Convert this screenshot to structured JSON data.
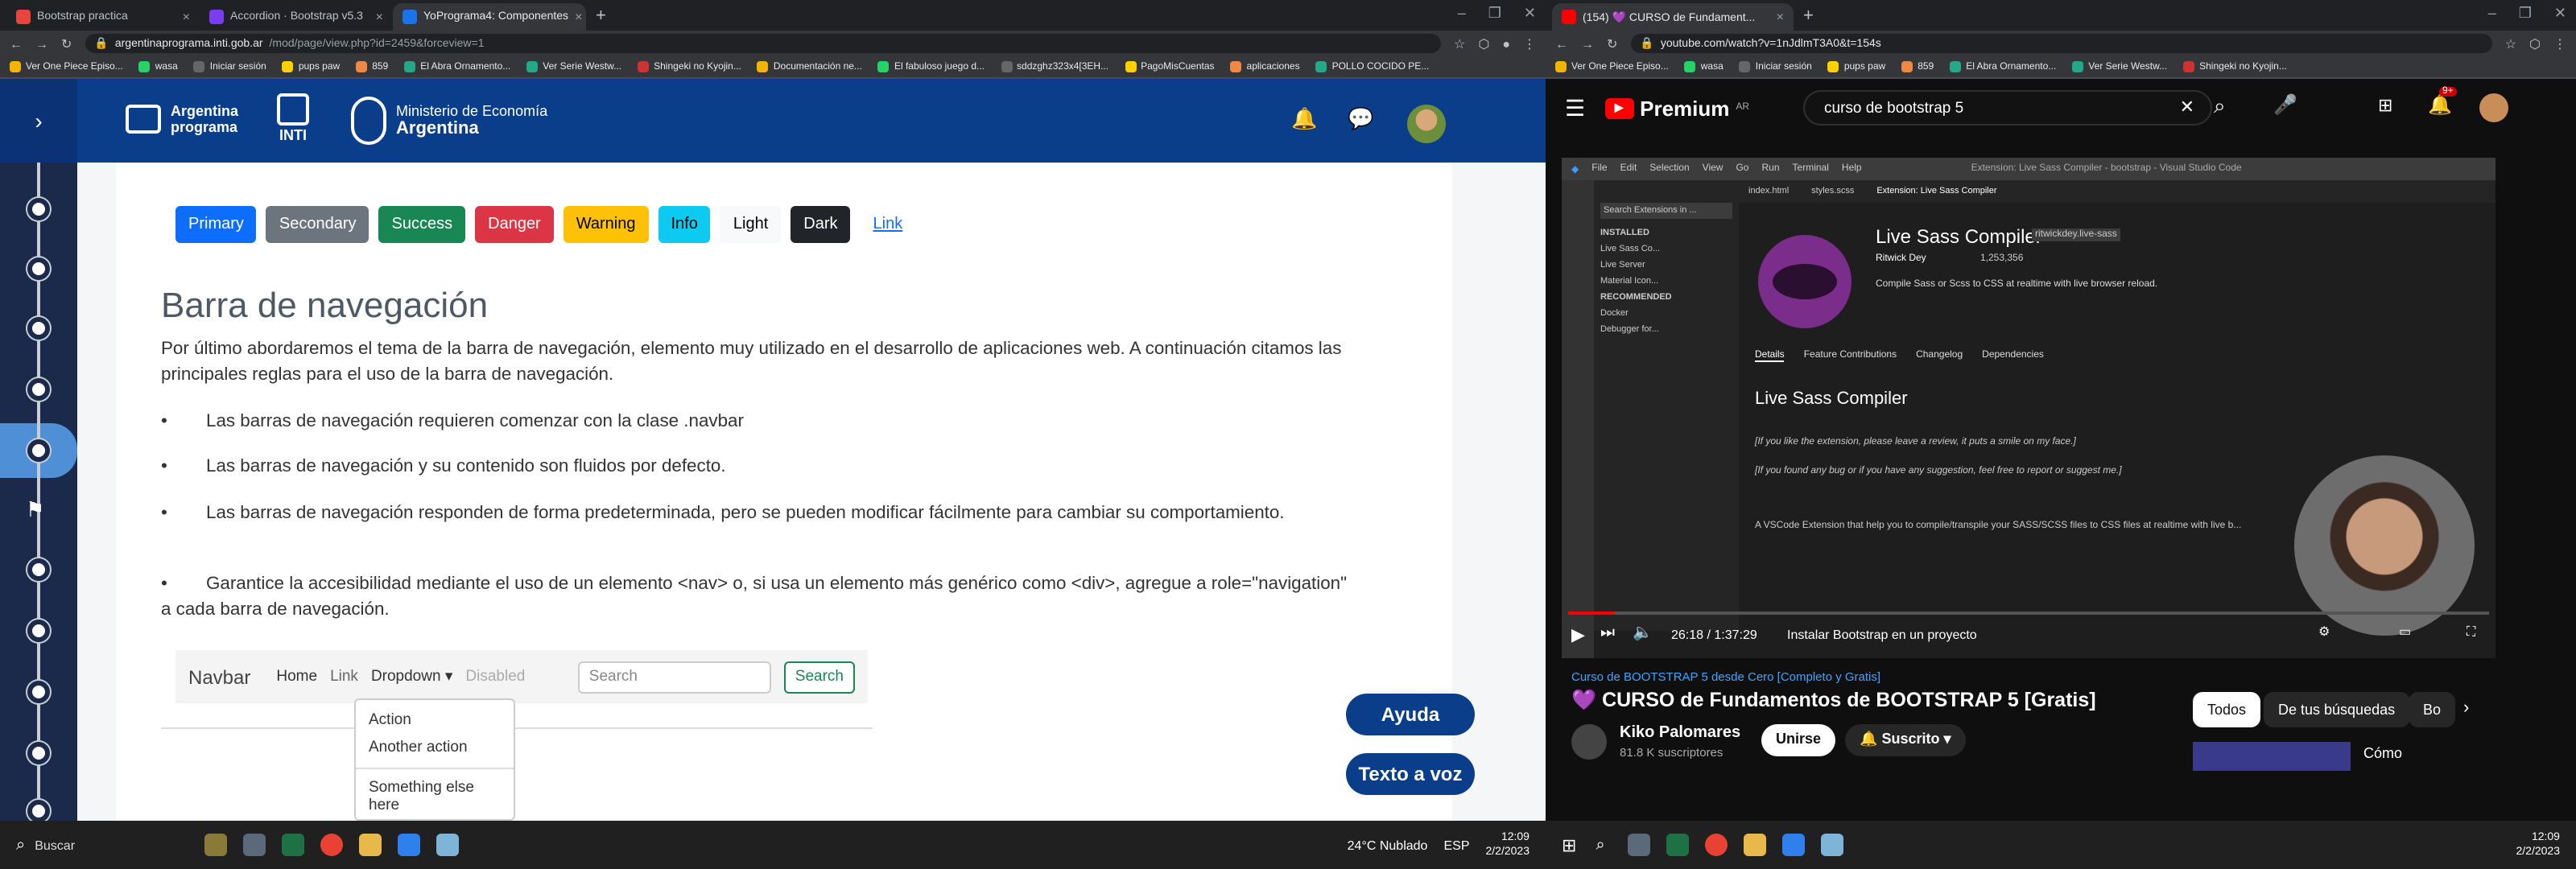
{
  "left": {
    "tabs": [
      {
        "label": "Bootstrap practica",
        "color": "#e8453c"
      },
      {
        "label": "Accordion · Bootstrap v5.3",
        "color": "#7a3ef0"
      },
      {
        "label": "YoPrograma4: Componentes",
        "color": "#1a73e8"
      }
    ],
    "url_domain": "argentinaprograma.inti.gob.ar",
    "url_path": "/mod/page/view.php?id=2459&forceview=1",
    "bookmarks": [
      "Ver One Piece Episo...",
      "wasa",
      "Iniciar sesión",
      "pups paw",
      "859",
      "El Abra Ornamento...",
      "Ver Serie Westw...",
      "Shingeki no Kyojin...",
      "Documentación ne...",
      "El fabuloso juego d...",
      "sddzghz323x4[3EH...",
      "PagoMisCuentas",
      "aplicaciones",
      "POLLO COCIDO PE..."
    ],
    "logo_argentina": "Argentina programa",
    "logo_inti": "INTI",
    "logo_ministerio_1": "Ministerio de Economía",
    "logo_ministerio_2": "Argentina",
    "buttons": [
      {
        "label": "Primary",
        "bg": "#0d6efd",
        "fg": "#fff"
      },
      {
        "label": "Secondary",
        "bg": "#6c757d",
        "fg": "#fff"
      },
      {
        "label": "Success",
        "bg": "#198754",
        "fg": "#fff"
      },
      {
        "label": "Danger",
        "bg": "#dc3545",
        "fg": "#fff"
      },
      {
        "label": "Warning",
        "bg": "#ffc107",
        "fg": "#000"
      },
      {
        "label": "Info",
        "bg": "#0dcaf0",
        "fg": "#000"
      },
      {
        "label": "Light",
        "bg": "#f8f9fa",
        "fg": "#000"
      },
      {
        "label": "Dark",
        "bg": "#212529",
        "fg": "#fff"
      }
    ],
    "link_label": "Link",
    "heading": "Barra de navegación",
    "paragraph": "Por último abordaremos el tema de la barra de navegación, elemento muy utilizado en el desarrollo de aplicaciones web. A continuación citamos las principales reglas para el uso de la barra de navegación.",
    "bullets": [
      "Las barras de navegación requieren comenzar con la clase .navbar",
      "Las barras de navegación y su contenido son fluidos por defecto.",
      "Las barras de navegación responden de forma predeterminada, pero se pueden modificar fácilmente para cambiar su comportamiento.",
      "Garantice la accesibilidad mediante el uso de un elemento <nav> o, si usa un elemento más genérico como <div>, agregue a role=\"navigation\" a cada barra de navegación."
    ],
    "navdemo": {
      "brand": "Navbar",
      "home": "Home",
      "link": "Link",
      "dropdown": "Dropdown",
      "disabled": "Disabled",
      "search_placeholder": "Search",
      "search_button": "Search"
    },
    "dropdown_items": [
      "Action",
      "Another action",
      "Something else here"
    ],
    "help_button": "Ayuda",
    "tts_button": "Texto a voz",
    "taskbar_search": "Buscar",
    "weather": "24°C Nublado",
    "lang": "ESP",
    "time": "12:09",
    "date": "2/2/2023"
  },
  "right": {
    "tab_label": "(154) 💜 CURSO de Fundament...",
    "url": "youtube.com/watch?v=1nJdlmT3A0&t=154s",
    "bookmarks": [
      "Ver One Piece Episo...",
      "wasa",
      "Iniciar sesión",
      "pups paw",
      "859",
      "El Abra Ornamento...",
      "Ver Serie Westw...",
      "Shingeki no Kyojin..."
    ],
    "logo": "Premium",
    "logo_region": "AR",
    "search_query": "curso de bootstrap 5",
    "notif_count": "9+",
    "vscode": {
      "menu": [
        "File",
        "Edit",
        "Selection",
        "View",
        "Go",
        "Run",
        "Terminal",
        "Help"
      ],
      "window_title": "Extension: Live Sass Compiler - bootstrap - Visual Studio Code",
      "tabs": [
        "index.html",
        "styles.scss",
        "Extension: Live Sass Compiler"
      ],
      "search_ext": "Search Extensions in ...",
      "installed_label": "INSTALLED",
      "recommended_label": "RECOMMENDED",
      "ext_list": [
        "Live Sass Co...",
        "Live Server",
        "Material Icon...",
        "Docker",
        "Debugger for..."
      ],
      "ext_name": "Live Sass Compiler",
      "ext_id": "ritwickdey.live-sass",
      "ext_author": "Ritwick Dey",
      "ext_installs": "1,253,356",
      "ext_desc": "Compile Sass or Scss to CSS at realtime with live browser reload.",
      "ext_heading": "Live Sass Compiler",
      "detail_tabs": [
        "Details",
        "Feature Contributions",
        "Changelog",
        "Dependencies"
      ],
      "line1": "[If you like the extension, please leave a review, it puts a smile on my face.]",
      "line2": "[If you found any bug or if you have any suggestion, feel free to report or suggest me.]",
      "line3": "A VSCode Extension that help you to compile/transpile your SASS/SCSS files to CSS files at realtime with live b..."
    },
    "time_display": "26:18 / 1:37:29",
    "chapter": "Instalar Bootstrap en un proyecto",
    "playlist": "Curso de BOOTSTRAP 5 desde Cero [Completo y Gratis]",
    "title": "💜 CURSO de Fundamentos de BOOTSTRAP 5 [Gratis]",
    "channel": "Kiko Palomares",
    "subs": "81.8 K suscriptores",
    "join": "Unirse",
    "subscribed": "Suscrito",
    "chips": [
      "Todos",
      "De tus búsquedas",
      "Bo"
    ],
    "side_video_title": "Cómo",
    "time": "12:09",
    "date": "2/2/2023"
  }
}
